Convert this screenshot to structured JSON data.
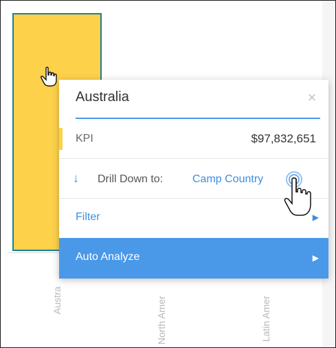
{
  "chart_data": {
    "type": "bar",
    "categories": [
      "Australia",
      "North America",
      "Latin America"
    ],
    "visible_category_labels": [
      "Austra",
      "North Amer",
      "Latin Amer"
    ]
  },
  "popup": {
    "title": "Australia",
    "close_icon": "close-icon",
    "kpi": {
      "label": "KPI",
      "value": "$97,832,651"
    },
    "drill": {
      "prefix": "Drill Down to:",
      "target": "Camp Country",
      "icon": "arrow-down-icon"
    },
    "filter": {
      "label": "Filter",
      "icon": "chevron-right-icon"
    },
    "auto_analyze": {
      "label": "Auto Analyze",
      "icon": "chevron-right-icon"
    }
  },
  "colors": {
    "bar_fill": "#fdd14a",
    "bar_border": "#1a7f99",
    "accent_blue": "#4a98e8",
    "link_blue": "#3d8ee0"
  }
}
